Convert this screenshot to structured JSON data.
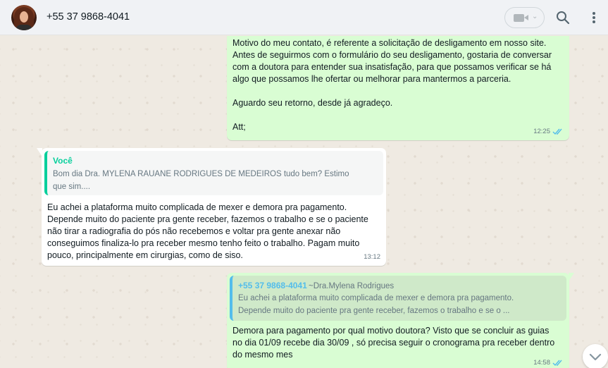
{
  "header": {
    "contact_name": "+55 37 9868-4041",
    "icons": [
      "avatar",
      "video-call-icon",
      "search-icon",
      "menu-icon"
    ]
  },
  "messages": [
    {
      "direction": "outgoing",
      "text": "Motivo do meu contato, é referente a solicitação de desligamento em nosso site.\nAntes de seguirmos com o formulário do seu desligamento, gostaria de conversar\ncom a doutora para entender sua insatisfação, para que possamos verificar se há\nalgo que possamos lhe ofertar ou melhorar para mantermos a parceria.\n\nAguardo seu retorno, desde já agradeço.\n\nAtt;",
      "time": "12:25",
      "status": "read"
    },
    {
      "direction": "incoming",
      "quote": {
        "author": "Você",
        "text": "Bom dia Dra. MYLENA RAUANE RODRIGUES DE MEDEIROS tudo bem? Estimo\nque sim...."
      },
      "text": "Eu achei a plataforma muito complicada de mexer e demora pra pagamento.\nDepende muito do paciente pra gente receber, fazemos o trabalho e se o paciente\nnão tirar a radiografia do pós não recebemos e voltar pra gente anexar não\nconseguimos finaliza-lo pra receber mesmo tenho feito o trabalho. Pagam muito\npouco, principalmente em cirurgias, como de siso.",
      "time": "13:12"
    },
    {
      "direction": "outgoing",
      "quote": {
        "author": "+55 37 9868-4041",
        "author_sub": "~Dra.Mylena Rodrigues",
        "text": "Eu achei a plataforma muito complicada de mexer e demora pra pagamento.\nDepende muito do paciente pra gente receber, fazemos o trabalho e se o ..."
      },
      "text": "Demora para pagamento por qual motivo doutora? Visto que se concluir as guias\nno dia 01/09 recebe dia 30/09 , só precisa seguir o cronograma pra receber dentro\ndo mesmo mes",
      "time": "14:58",
      "status": "read"
    }
  ],
  "colors": {
    "outgoing_bubble": "#d9fdd3",
    "incoming_bubble": "#ffffff",
    "read_ticks": "#53bdeb",
    "quote_you": "#06cf9c",
    "quote_contact": "#53bdeb"
  }
}
